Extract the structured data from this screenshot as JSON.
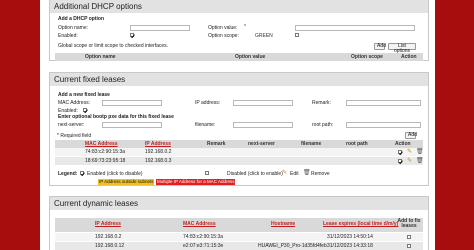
{
  "dhcp_options": {
    "title": "Additional DHCP options",
    "add_label": "Add a DHCP option",
    "option_name_label": "Option name:",
    "option_value_label": "Option value:",
    "enabled_label": "Enabled:",
    "option_scope_label": "Option scope:",
    "option_scope_value": "GREEN",
    "global_note": "Global scope or limit scope to checked interfaces.",
    "add_button": "Add",
    "list_button": "List options",
    "headers": [
      "Option name",
      "Option value",
      "Option scope",
      "Action"
    ]
  },
  "fixed_leases": {
    "title": "Current fixed leases",
    "add_label": "Add a new fixed lease",
    "mac_label": "MAC Address:",
    "ip_label": "IP address:",
    "remark_label": "Remark:",
    "enabled_label": "Enabled:",
    "pxe_label": "Enter optional bootp pxe data for this fixed lease",
    "next_server_label": "next-server:",
    "filename_label": "filename:",
    "root_path_label": "root path:",
    "required_note": "Required field",
    "add_button": "Add",
    "headers": [
      "MAC Address",
      "IP Address",
      "Remark",
      "next-server",
      "filename",
      "root path",
      "Action"
    ],
    "rows": [
      {
        "mac": "74:83:c2:90:15:3a",
        "ip": "192.168.0.2"
      },
      {
        "mac": "18:69:73:23:95:18",
        "ip": "192.168.0.3"
      }
    ]
  },
  "legend": {
    "label": "Legend:",
    "enabled_text": "Enabled (click to disable)",
    "disabled_text": "Disabled (click to enable)",
    "edit_text": "Edit",
    "remove_text": "Remove",
    "outside_subnet_text": "IP Address outside subnets",
    "multiple_text": "Multiple IP Address for a MAC Address",
    "outside_color": "#f0c020",
    "multiple_color": "#e02020"
  },
  "dynamic_leases": {
    "title": "Current dynamic leases",
    "headers": [
      "IP Address",
      "MAC Address",
      "Hostname",
      "Lease expires (local time d/m/y)",
      "Add to fix leases"
    ],
    "rows": [
      {
        "ip": "192.168.0.2",
        "mac": "74:83:c2:90:15:3a",
        "hostname": "",
        "expires": "31/12/2023 14:50:14"
      },
      {
        "ip": "192.168.0.12",
        "mac": "e2:07:e3:71:15:3e",
        "hostname": "HUAWEI_P30_Pro-1d35fd4feb",
        "expires": "31/12/2023 14:33:18"
      }
    ]
  },
  "colors": {
    "brand_red": "#a80d0d",
    "header_gray": "#d9d9d9",
    "link_red": "#c02020"
  }
}
